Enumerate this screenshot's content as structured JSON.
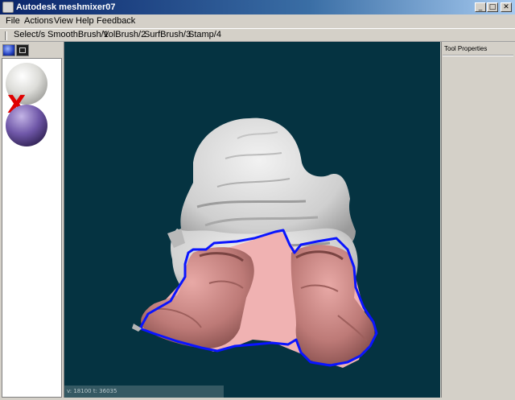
{
  "window": {
    "title": "Autodesk meshmixer07",
    "minimize_glyph": "_",
    "maximize_glyph": "□",
    "close_glyph": "✕"
  },
  "menu": [
    {
      "label": "File"
    },
    {
      "label": "Actions"
    },
    {
      "label": "View"
    },
    {
      "label": "Help"
    },
    {
      "label": "Feedback"
    }
  ],
  "toolbar": [
    {
      "label": "Select/s"
    },
    {
      "label": "SmoothBrush/1"
    },
    {
      "label": "VolBrush/2"
    },
    {
      "label": "SurfBrush/3"
    },
    {
      "label": "Stamp/4"
    }
  ],
  "left_panel": {
    "delete_mark": "X"
  },
  "viewport": {
    "status": "v: 18100 t: 36035",
    "background_color": "#053341",
    "selection_color": "#0a14ff",
    "selected_region_color": "#f0b2b2"
  },
  "right_panel": {
    "title": "Tool Properties"
  }
}
